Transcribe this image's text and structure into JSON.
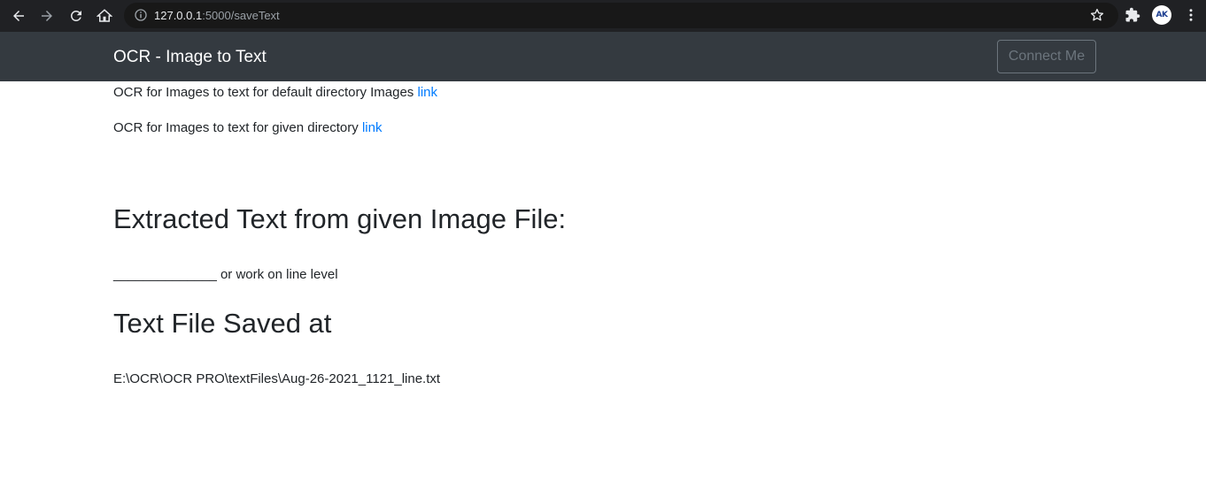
{
  "browser": {
    "url_host": "127.0.0.1",
    "url_path": ":5000/saveText",
    "avatar_text": "AK"
  },
  "navbar": {
    "brand": "OCR - Image to Text",
    "connect_label": "Connect Me"
  },
  "links": [
    {
      "text": "OCR for Images to text for default directory Images ",
      "link_label": "link"
    },
    {
      "text": "OCR for Images to text for given directory ",
      "link_label": "link"
    }
  ],
  "extracted": {
    "heading": "Extracted Text from given Image File:",
    "text": "______________ or work on line level"
  },
  "saved": {
    "heading": "Text File Saved at",
    "path": "E:\\OCR\\OCR PRO\\textFiles\\Aug-26-2021_1121_line.txt"
  },
  "colors": {
    "navbar_bg": "#343a40",
    "link": "#007bff",
    "chrome_bg": "#202124"
  }
}
